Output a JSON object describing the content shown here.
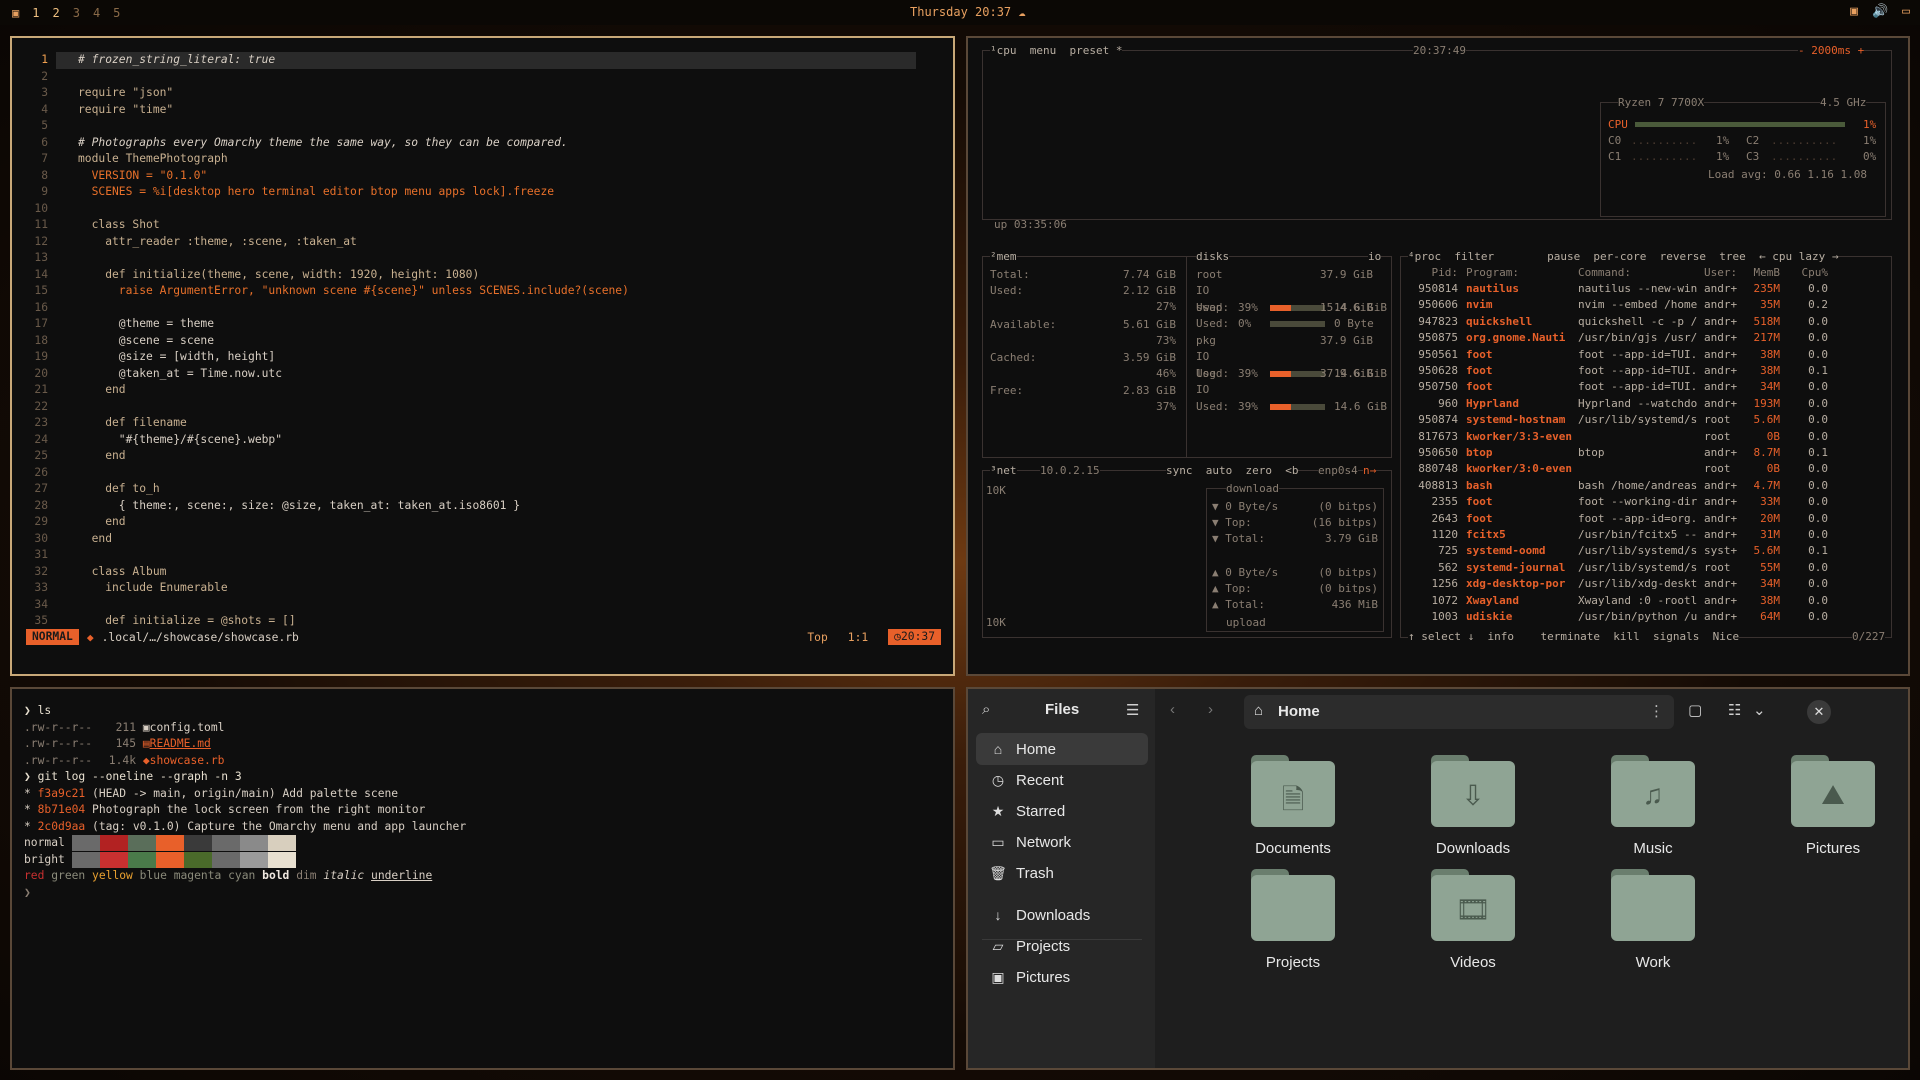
{
  "topbar": {
    "workspaces": [
      "1",
      "2",
      "3",
      "4",
      "5"
    ],
    "clock": "Thursday 20:37"
  },
  "editor": {
    "lines": [
      {
        "n": "1",
        "t": "# frozen_string_literal: true"
      },
      {
        "n": "2",
        "t": ""
      },
      {
        "n": "3",
        "t": "require \"json\""
      },
      {
        "n": "4",
        "t": "require \"time\""
      },
      {
        "n": "5",
        "t": ""
      },
      {
        "n": "6",
        "t": "# Photographs every Omarchy theme the same way, so they can be compared."
      },
      {
        "n": "7",
        "t": "module ThemePhotograph"
      },
      {
        "n": "8",
        "t": "  VERSION = \"0.1.0\""
      },
      {
        "n": "9",
        "t": "  SCENES = %i[desktop hero terminal editor btop menu apps lock].freeze"
      },
      {
        "n": "10",
        "t": ""
      },
      {
        "n": "11",
        "t": "  class Shot"
      },
      {
        "n": "12",
        "t": "    attr_reader :theme, :scene, :taken_at"
      },
      {
        "n": "13",
        "t": ""
      },
      {
        "n": "14",
        "t": "    def initialize(theme, scene, width: 1920, height: 1080)"
      },
      {
        "n": "15",
        "t": "      raise ArgumentError, \"unknown scene #{scene}\" unless SCENES.include?(scene)"
      },
      {
        "n": "16",
        "t": ""
      },
      {
        "n": "17",
        "t": "      @theme = theme"
      },
      {
        "n": "18",
        "t": "      @scene = scene"
      },
      {
        "n": "19",
        "t": "      @size = [width, height]"
      },
      {
        "n": "20",
        "t": "      @taken_at = Time.now.utc"
      },
      {
        "n": "21",
        "t": "    end"
      },
      {
        "n": "22",
        "t": ""
      },
      {
        "n": "23",
        "t": "    def filename"
      },
      {
        "n": "24",
        "t": "      \"#{theme}/#{scene}.webp\""
      },
      {
        "n": "25",
        "t": "    end"
      },
      {
        "n": "26",
        "t": ""
      },
      {
        "n": "27",
        "t": "    def to_h"
      },
      {
        "n": "28",
        "t": "      { theme:, scene:, size: @size, taken_at: taken_at.iso8601 }"
      },
      {
        "n": "29",
        "t": "    end"
      },
      {
        "n": "30",
        "t": "  end"
      },
      {
        "n": "31",
        "t": ""
      },
      {
        "n": "32",
        "t": "  class Album"
      },
      {
        "n": "33",
        "t": "    include Enumerable"
      },
      {
        "n": "34",
        "t": ""
      },
      {
        "n": "35",
        "t": "    def initialize = @shots = []"
      }
    ],
    "status": {
      "mode": "NORMAL",
      "file": ".local/…/showcase/showcase.rb",
      "position": "Top",
      "cursor": "1:1",
      "time": "20:37"
    }
  },
  "btop": {
    "cpu_title": "¹cpu  menu  preset *",
    "clock": "20:37:49",
    "interval": "- 2000ms +",
    "cpu_model": "Ryzen 7 7700X",
    "freq": "4.5 GHz",
    "cpu_rows": [
      "CPU",
      "C0",
      "C1",
      "C2",
      "C3"
    ],
    "cpu_vals": [
      "1%",
      "1%",
      "1%",
      "1%",
      "0%"
    ],
    "load": "Load avg: 0.66 1.16 1.08",
    "uptime": "up 03:35:06",
    "mem": {
      "title": "²mem",
      "total": "7.74 GiB",
      "used": "2.12 GiB",
      "used_pct": "27%",
      "available": "5.61 GiB",
      "avail_pct": "73%",
      "cached": "3.59 GiB",
      "cached_pct": "46%",
      "free": "2.83 GiB",
      "free_pct": "37%"
    },
    "disks": [
      {
        "name": "root",
        "size": "37.9 GiB",
        "used_pct": "39%",
        "used": "14.6 GiB"
      },
      {
        "name": "swap",
        "size": "15.4 GiB",
        "used_pct": "0%",
        "used": "0 Byte"
      },
      {
        "name": "pkg",
        "size": "37.9 GiB",
        "used_pct": "39%",
        "used": "14.6 GiB"
      },
      {
        "name": "log",
        "size": "37.9 GiB",
        "used_pct": "39%",
        "used": "14.6 GiB"
      }
    ],
    "net": {
      "title": "³net",
      "ip": "10.0.2.15",
      "iface": "enp0s4",
      "scale_top": "10K",
      "scale_bottom": "10K",
      "download": [
        {
          "k": "▼ 0 Byte/s",
          "v": "(0 bitps)"
        },
        {
          "k": "▼ Top:",
          "v": "(16 bitps)"
        },
        {
          "k": "▼ Total:",
          "v": "3.79 GiB"
        }
      ],
      "upload": [
        {
          "k": "▲ 0 Byte/s",
          "v": "(0 bitps)"
        },
        {
          "k": "▲ Top:",
          "v": "(0 bitps)"
        },
        {
          "k": "▲ Total:",
          "v": "436 MiB"
        }
      ]
    },
    "proc_header": "⁴proc  filter        pause  per-core  reverse  tree  ← cpu lazy →",
    "proc_cols": [
      "Pid:",
      "Program:",
      "Command:",
      "User:",
      "MemB",
      "Cpu%"
    ],
    "procs": [
      [
        "950814",
        "nautilus",
        "nautilus --new-win",
        "andr+",
        "235M",
        "0.0"
      ],
      [
        "950606",
        "nvim",
        "nvim --embed /home",
        "andr+",
        "35M",
        "0.2"
      ],
      [
        "947823",
        "quickshell",
        "quickshell -c -p /",
        "andr+",
        "518M",
        "0.0"
      ],
      [
        "950875",
        "org.gnome.Nauti",
        "/usr/bin/gjs /usr/",
        "andr+",
        "217M",
        "0.0"
      ],
      [
        "950561",
        "foot",
        "foot --app-id=TUI.",
        "andr+",
        "38M",
        "0.0"
      ],
      [
        "950628",
        "foot",
        "foot --app-id=TUI.",
        "andr+",
        "38M",
        "0.1"
      ],
      [
        "950750",
        "foot",
        "foot --app-id=TUI.",
        "andr+",
        "34M",
        "0.0"
      ],
      [
        "960",
        "Hyprland",
        "Hyprland --watchdo",
        "andr+",
        "193M",
        "0.0"
      ],
      [
        "950874",
        "systemd-hostnam",
        "/usr/lib/systemd/s",
        "root",
        "5.6M",
        "0.0"
      ],
      [
        "817673",
        "kworker/3:3-even",
        "",
        "root",
        "0B",
        "0.0"
      ],
      [
        "950650",
        "btop",
        "btop",
        "andr+",
        "8.7M",
        "0.1"
      ],
      [
        "880748",
        "kworker/3:0-even",
        "",
        "root",
        "0B",
        "0.0"
      ],
      [
        "408813",
        "bash",
        "bash /home/andreas",
        "andr+",
        "4.7M",
        "0.0"
      ],
      [
        "2355",
        "foot",
        "foot --working-dir",
        "andr+",
        "33M",
        "0.0"
      ],
      [
        "2643",
        "foot",
        "foot --app-id=org.",
        "andr+",
        "20M",
        "0.0"
      ],
      [
        "1120",
        "fcitx5",
        "/usr/bin/fcitx5 --",
        "andr+",
        "31M",
        "0.0"
      ],
      [
        "725",
        "systemd-oomd",
        "/usr/lib/systemd/s",
        "syst+",
        "5.6M",
        "0.1"
      ],
      [
        "562",
        "systemd-journal",
        "/usr/lib/systemd/s",
        "root",
        "55M",
        "0.0"
      ],
      [
        "1256",
        "xdg-desktop-por",
        "/usr/lib/xdg-deskt",
        "andr+",
        "34M",
        "0.0"
      ],
      [
        "1072",
        "Xwayland",
        "Xwayland :0 -rootl",
        "andr+",
        "38M",
        "0.0"
      ],
      [
        "1003",
        "udiskie",
        "/usr/bin/python /u",
        "andr+",
        "64M",
        "0.0"
      ]
    ],
    "proc_footer": "↑ select ↓  info    terminate  kill  signals  Nice",
    "proc_count": "0/227"
  },
  "terminal": {
    "prompt1": "❯ ls",
    "files": [
      {
        "perm": ".rw-r--r--",
        "size": "211",
        "icon": "",
        "name": "config.toml"
      },
      {
        "perm": ".rw-r--r--",
        "size": "145",
        "icon": "",
        "name": "README.md"
      },
      {
        "perm": ".rw-r--r--",
        "size": "1.4k",
        "icon": "",
        "name": "showcase.rb"
      }
    ],
    "prompt2": "❯ git log --oneline --graph -n 3",
    "commits": [
      {
        "hash": "f3a9c21",
        "ref": "(HEAD -> main, origin/main)",
        "msg": "Add palette scene"
      },
      {
        "hash": "8b71e04",
        "ref": "",
        "msg": "Photograph the lock screen from the right monitor"
      },
      {
        "hash": "2c0d9aa",
        "ref": "(tag: v0.1.0)",
        "msg": "Capture the Omarchy menu and app launcher"
      }
    ],
    "normal_label": "normal",
    "bright_label": "bright",
    "normal_colors": [
      "#6a6a6a",
      "#b22222",
      "#5a6e5a",
      "#e8602a",
      "#3a3a3a",
      "#6a6a6a",
      "#8a8a8a",
      "#d8cfbe"
    ],
    "bright_colors": [
      "#6a6a6a",
      "#c83030",
      "#4a7a4a",
      "#e8602a",
      "#4a6a2a",
      "#6a6a6a",
      "#9a9a9a",
      "#e8e0d0"
    ],
    "styles": [
      "red",
      "green",
      "yellow",
      "blue",
      "magenta",
      "cyan",
      "bold",
      "dim",
      "italic",
      "underline"
    ],
    "prompt3": "❯"
  },
  "files": {
    "title": "Files",
    "location": "Home",
    "sidebar": [
      {
        "icon": "⌂",
        "label": "Home"
      },
      {
        "icon": "◷",
        "label": "Recent"
      },
      {
        "icon": "★",
        "label": "Starred"
      },
      {
        "icon": "▭",
        "label": "Network"
      },
      {
        "icon": "🗑",
        "label": "Trash"
      },
      {
        "icon": "↓",
        "label": "Downloads"
      },
      {
        "icon": "▱",
        "label": "Projects"
      },
      {
        "icon": "▣",
        "label": "Pictures"
      }
    ],
    "folders": [
      {
        "label": "Documents",
        "glyph": "🗎"
      },
      {
        "label": "Downloads",
        "glyph": "⇩"
      },
      {
        "label": "Music",
        "glyph": "♫"
      },
      {
        "label": "Pictures",
        "glyph": "⛰"
      },
      {
        "label": "Projects",
        "glyph": ""
      },
      {
        "label": "Videos",
        "glyph": "🎞"
      },
      {
        "label": "Work",
        "glyph": ""
      }
    ]
  }
}
